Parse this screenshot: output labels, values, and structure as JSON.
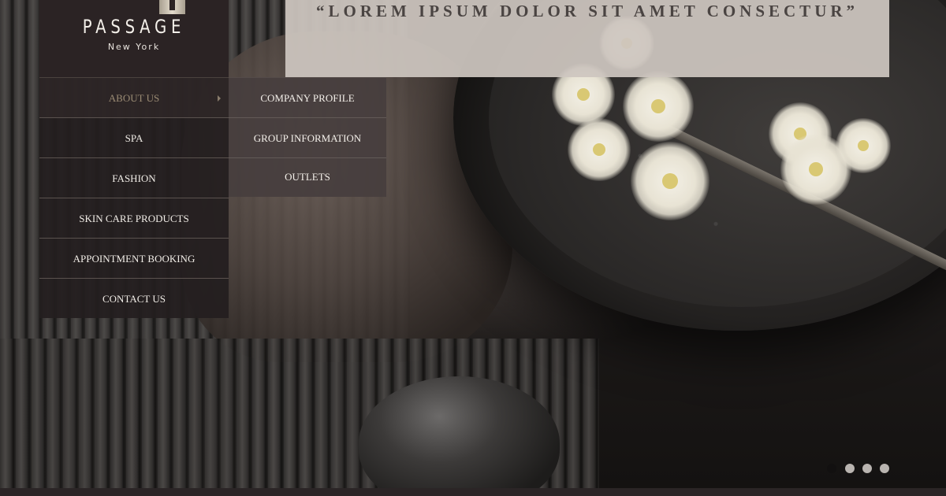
{
  "banner": {
    "quote": "“LOREM IPSUM DOLOR SIT AMET CONSECTUR”"
  },
  "logo": {
    "name": "PASSAGE",
    "city": "New York"
  },
  "nav": {
    "items": [
      {
        "label": "ABOUT US",
        "active": true
      },
      {
        "label": "SPA"
      },
      {
        "label": "FASHION"
      },
      {
        "label": "SKIN CARE PRODUCTS"
      },
      {
        "label": "APPOINTMENT BOOKING"
      },
      {
        "label": "CONTACT US"
      }
    ]
  },
  "subnav": {
    "items": [
      {
        "label": "COMPANY PROFILE"
      },
      {
        "label": "GROUP INFORMATION"
      },
      {
        "label": "OUTLETS"
      }
    ]
  },
  "slider": {
    "total": 4,
    "active_index": 0
  },
  "colors": {
    "nav_active_text": "#9a8b74",
    "nav_bg": "#241e1f",
    "banner_bg": "#cdc6c0"
  }
}
